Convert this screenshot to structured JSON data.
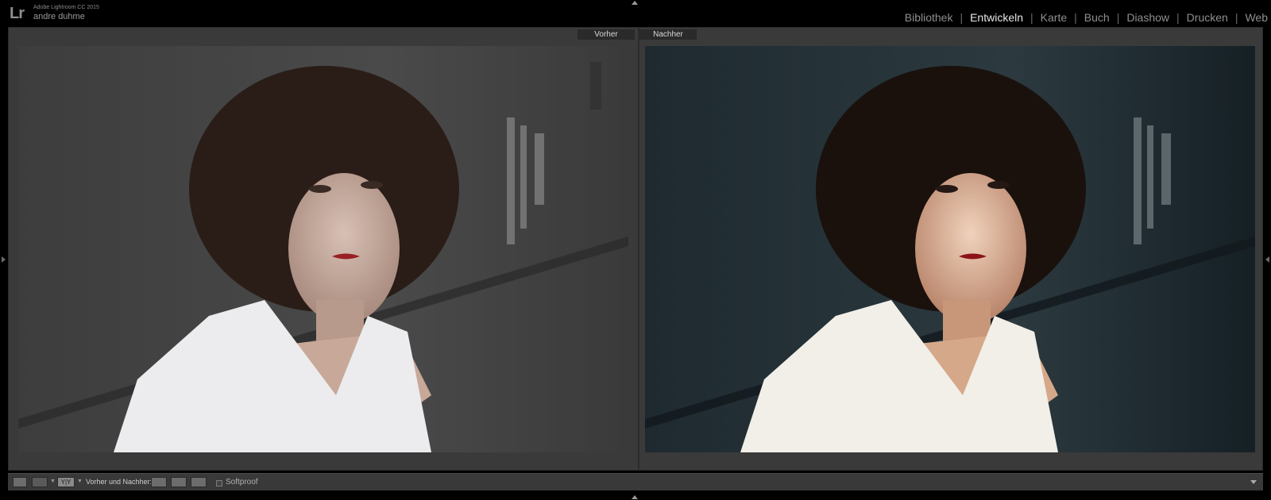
{
  "header": {
    "logo": "Lr",
    "app_name": "Adobe Lightroom CC 2015",
    "user_name": "andre duhme"
  },
  "module_nav": {
    "items": [
      {
        "label": "Bibliothek",
        "active": false
      },
      {
        "label": "Entwickeln",
        "active": true
      },
      {
        "label": "Karte",
        "active": false
      },
      {
        "label": "Buch",
        "active": false
      },
      {
        "label": "Diashow",
        "active": false
      },
      {
        "label": "Drucken",
        "active": false
      },
      {
        "label": "Web",
        "active": false
      }
    ],
    "separator": "|"
  },
  "view": {
    "before_label": "Vorher",
    "after_label": "Nachher"
  },
  "toolbar": {
    "yy_label": "Y|Y",
    "before_after_label": "Vorher und Nachher:",
    "softproof_label": "Softproof"
  },
  "colors": {
    "accent_active": "#e6e6e6",
    "nav_inactive": "#8f8f8f",
    "workspace_bg": "#3a3a3a"
  }
}
